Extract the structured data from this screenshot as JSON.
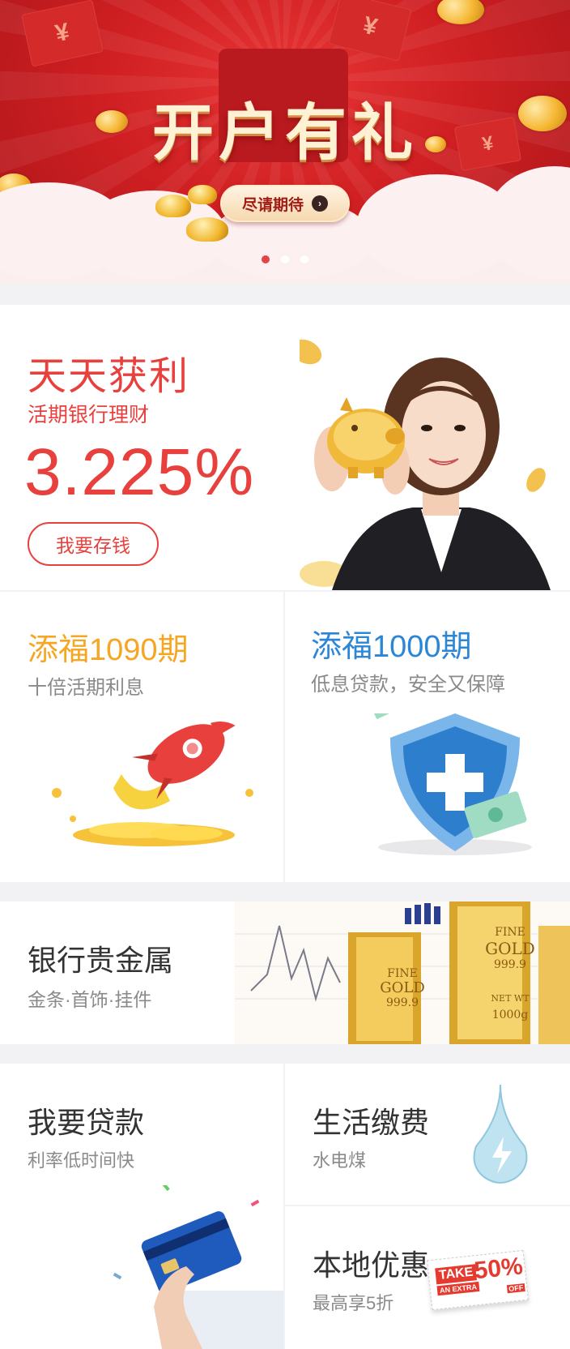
{
  "banner": {
    "title": "开户有礼",
    "cta_label": "尽请期待",
    "cta_arrow": "›",
    "envelope_symbol": "¥",
    "dots_count": 3,
    "active_dot": 0
  },
  "featured": {
    "title": "天天获利",
    "subtitle": "活期银行理财",
    "rate": "3.225%",
    "button_label": "我要存钱",
    "color": "#e8403d"
  },
  "products": [
    {
      "title": "添福1090期",
      "subtitle": "十倍活期利息",
      "color": "#f5a623",
      "icon": "rocket-icon"
    },
    {
      "title": "添福1000期",
      "subtitle": "低息贷款，安全又保障",
      "color": "#2b86d6",
      "icon": "shield-icon"
    }
  ],
  "metal": {
    "title": "银行贵金属",
    "subtitle": "金条·首饰·挂件",
    "bar1_lines": [
      "FINE",
      "GOLD",
      "999.9"
    ],
    "bar2_lines": [
      "FINE",
      "GOLD",
      "999.9",
      "NET WT",
      "1000g"
    ]
  },
  "loan": {
    "title": "我要贷款",
    "subtitle": "利率低时间快",
    "icon": "credit-card-icon"
  },
  "life": {
    "title": "生活缴费",
    "subtitle": "水电煤",
    "icon": "water-drop-icon"
  },
  "local": {
    "title": "本地优惠",
    "subtitle": "最高享5折",
    "coupon_take": "TAKE",
    "coupon_extra": "AN EXTRA",
    "coupon_percent": "50%",
    "coupon_off": "OFF"
  }
}
